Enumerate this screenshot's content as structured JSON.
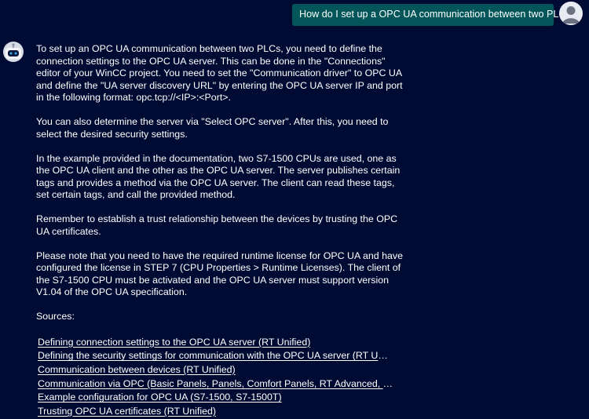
{
  "user_message": {
    "text": "How do I set up a OPC UA communication between two PLCs?"
  },
  "assistant": {
    "paragraphs": [
      "To set up an OPC UA communication between two PLCs, you need to define the connection settings to the OPC UA server. This can be done in the \"Connections\" editor of your WinCC project. You need to set the \"Communication driver\" to OPC UA and define the \"UA server discovery URL\" by entering the OPC UA server IP and port in the following format: opc.tcp://<IP>:<Port>.",
      "You can also determine the server via \"Select OPC server\". After this, you need to select the desired security settings.",
      "In the example provided in the documentation, two S7-1500 CPUs are used, one as the OPC UA client and the other as the OPC UA server. The server publishes certain tags and provides a method via the OPC UA server. The client can read these tags, set certain tags, and call the provided method.",
      "Remember to establish a trust relationship between the devices by trusting the OPC UA certificates.",
      "Please note that you need to have the required runtime license for OPC UA and have configured the license in STEP 7 (CPU Properties > Runtime Licenses). The client of the S7-1500 CPU must be activated and the OPC UA server must support version V1.04 of the OPC UA specification."
    ],
    "sources_label": "Sources:",
    "sources": [
      "Defining connection settings to the OPC UA server (RT Unified)",
      "Defining the security settings for communication with the OPC UA server (RT Unified)",
      "Communication between devices (RT Unified)",
      "Communication via OPC (Basic Panels, Panels, Comfort Panels, RT Advanced, RT Profe...",
      "Example configuration for OPC UA (S7-1500, S7-1500T)",
      "Trusting OPC UA certificates (RT Unified)"
    ]
  },
  "icons": {
    "user_avatar": "user-avatar-icon",
    "bot_avatar": "robot-icon"
  },
  "colors": {
    "background": "#000b33",
    "user_bubble": "#02565a",
    "text": "#ffffff"
  }
}
